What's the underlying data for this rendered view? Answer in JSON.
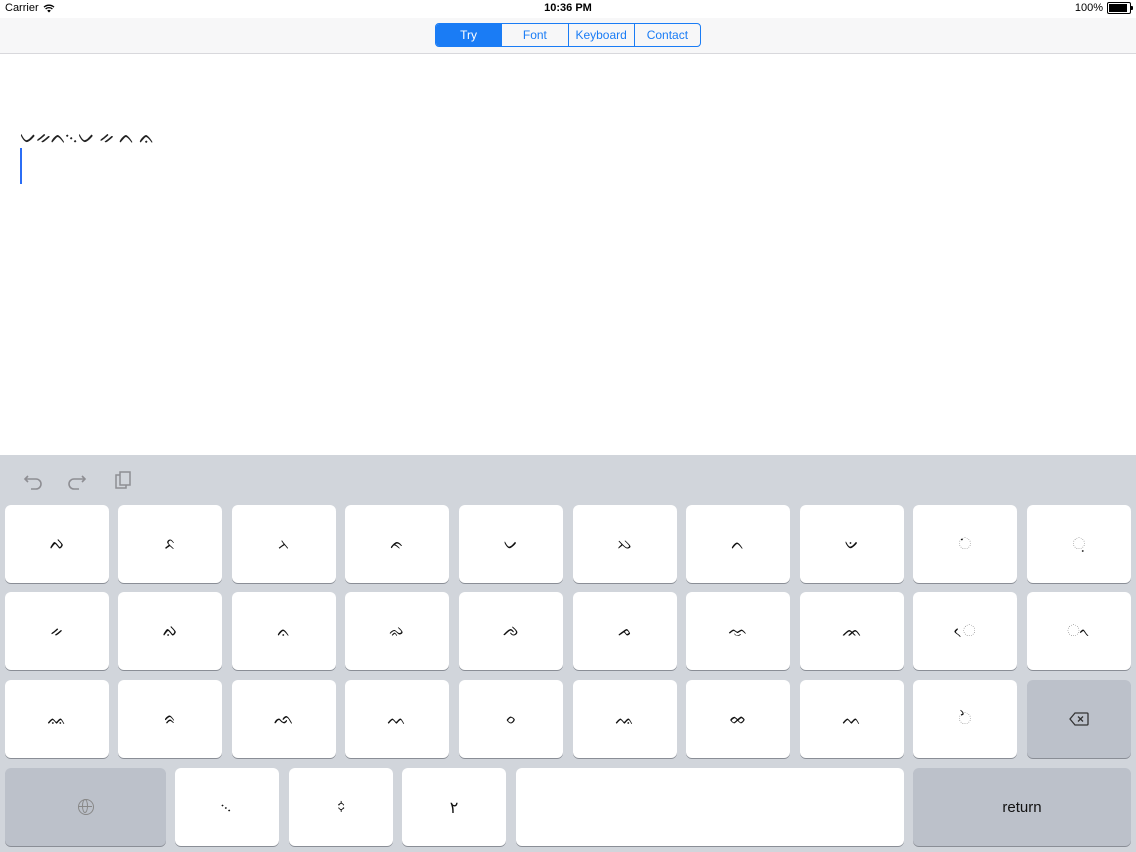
{
  "status_bar": {
    "carrier": "Carrier",
    "time": "10:36 PM",
    "battery_percent": "100%",
    "battery_level": 1.0
  },
  "nav": {
    "tabs": [
      {
        "label": "Try",
        "active": true
      },
      {
        "label": "Font",
        "active": false
      },
      {
        "label": "Keyboard",
        "active": false
      },
      {
        "label": "Contact",
        "active": false
      }
    ]
  },
  "editor": {
    "text": "ᨆᨀᨈ᨞ᨆ ᨀ ᨈ ᨊ"
  },
  "keyboard": {
    "toolbar": {
      "undo_icon": "undo-icon",
      "redo_icon": "redo-icon",
      "paste_icon": "paste-icon"
    },
    "row1": [
      "ᨄ",
      "ᨅ",
      "ᨂ",
      "ᨃ",
      "ᨆ",
      "ᨇ",
      "ᨈ",
      "ᨉ",
      "ᨗ",
      "ᨘ"
    ],
    "row2": [
      "ᨀ",
      "ᨁ",
      "ᨊ",
      "ᨋ",
      "ᨌ",
      "ᨍ",
      "ᨎ",
      "ᨏ",
      "ᨙ",
      "ᨚ"
    ],
    "row3": [
      "ᨐ",
      "ᨑ",
      "ᨒ",
      "ᨓ",
      "ᨔ",
      "ᨕ",
      "ᨖ",
      "ᨓ",
      "ᨛ"
    ],
    "row4": {
      "globe_icon": "globe-icon",
      "keys": [
        "᨞",
        "᨟",
        "٢"
      ],
      "return_label": "return"
    },
    "backspace_icon": "backspace-icon"
  },
  "colors": {
    "accent": "#1a7cf5",
    "keyboard_bg": "#d1d5db",
    "key_bg": "#ffffff",
    "fn_key_bg": "#bcc1ca"
  }
}
